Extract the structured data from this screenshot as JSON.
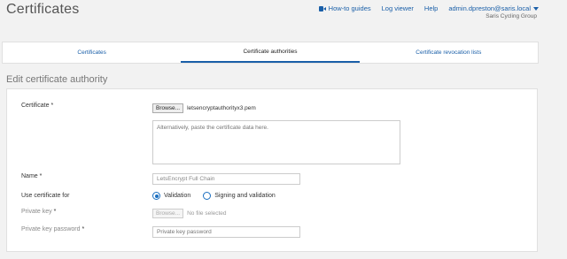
{
  "header": {
    "title": "Certificates",
    "links": {
      "howto": "How-to guides",
      "logviewer": "Log viewer",
      "help": "Help",
      "user": "admin.dpreston@saris.local",
      "org": "Saris Cycling Group"
    },
    "howto_icon": "video-camera-icon"
  },
  "tabs": [
    {
      "label": "Certificates",
      "active": false
    },
    {
      "label": "Certificate authorities",
      "active": true
    },
    {
      "label": "Certificate revocation lists",
      "active": false
    }
  ],
  "section_title": "Edit certificate authority",
  "form": {
    "certificate": {
      "label": "Certificate",
      "required": "*",
      "browse_label": "Browse...",
      "file_name": "letsencryptauthorityx3.pem",
      "textarea_placeholder": "Alternatively, paste the certificate data here."
    },
    "name": {
      "label": "Name",
      "required": "*",
      "value": "LetsEncrypt Full Chain"
    },
    "use_for": {
      "label": "Use certificate for",
      "options": [
        "Validation",
        "Signing and validation"
      ],
      "selected": "Validation"
    },
    "private_key": {
      "label": "Private key",
      "required": "*",
      "browse_label": "Browse...",
      "file_name": "No file selected"
    },
    "private_key_password": {
      "label": "Private key password",
      "required": "*",
      "placeholder": "Private key password"
    }
  },
  "colors": {
    "accent": "#1a5fa8",
    "radio": "#1a6fc0",
    "background": "#f2f2f2"
  }
}
